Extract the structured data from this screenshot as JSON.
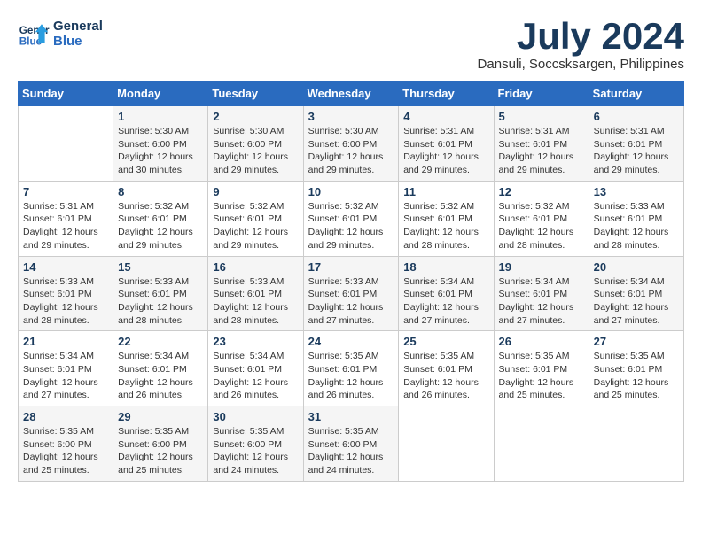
{
  "header": {
    "logo_line1": "General",
    "logo_line2": "Blue",
    "month": "July 2024",
    "location": "Dansuli, Soccsksargen, Philippines"
  },
  "weekdays": [
    "Sunday",
    "Monday",
    "Tuesday",
    "Wednesday",
    "Thursday",
    "Friday",
    "Saturday"
  ],
  "weeks": [
    [
      {
        "day": "",
        "info": ""
      },
      {
        "day": "1",
        "info": "Sunrise: 5:30 AM\nSunset: 6:00 PM\nDaylight: 12 hours\nand 30 minutes."
      },
      {
        "day": "2",
        "info": "Sunrise: 5:30 AM\nSunset: 6:00 PM\nDaylight: 12 hours\nand 29 minutes."
      },
      {
        "day": "3",
        "info": "Sunrise: 5:30 AM\nSunset: 6:00 PM\nDaylight: 12 hours\nand 29 minutes."
      },
      {
        "day": "4",
        "info": "Sunrise: 5:31 AM\nSunset: 6:01 PM\nDaylight: 12 hours\nand 29 minutes."
      },
      {
        "day": "5",
        "info": "Sunrise: 5:31 AM\nSunset: 6:01 PM\nDaylight: 12 hours\nand 29 minutes."
      },
      {
        "day": "6",
        "info": "Sunrise: 5:31 AM\nSunset: 6:01 PM\nDaylight: 12 hours\nand 29 minutes."
      }
    ],
    [
      {
        "day": "7",
        "info": "Sunrise: 5:31 AM\nSunset: 6:01 PM\nDaylight: 12 hours\nand 29 minutes."
      },
      {
        "day": "8",
        "info": "Sunrise: 5:32 AM\nSunset: 6:01 PM\nDaylight: 12 hours\nand 29 minutes."
      },
      {
        "day": "9",
        "info": "Sunrise: 5:32 AM\nSunset: 6:01 PM\nDaylight: 12 hours\nand 29 minutes."
      },
      {
        "day": "10",
        "info": "Sunrise: 5:32 AM\nSunset: 6:01 PM\nDaylight: 12 hours\nand 29 minutes."
      },
      {
        "day": "11",
        "info": "Sunrise: 5:32 AM\nSunset: 6:01 PM\nDaylight: 12 hours\nand 28 minutes."
      },
      {
        "day": "12",
        "info": "Sunrise: 5:32 AM\nSunset: 6:01 PM\nDaylight: 12 hours\nand 28 minutes."
      },
      {
        "day": "13",
        "info": "Sunrise: 5:33 AM\nSunset: 6:01 PM\nDaylight: 12 hours\nand 28 minutes."
      }
    ],
    [
      {
        "day": "14",
        "info": "Sunrise: 5:33 AM\nSunset: 6:01 PM\nDaylight: 12 hours\nand 28 minutes."
      },
      {
        "day": "15",
        "info": "Sunrise: 5:33 AM\nSunset: 6:01 PM\nDaylight: 12 hours\nand 28 minutes."
      },
      {
        "day": "16",
        "info": "Sunrise: 5:33 AM\nSunset: 6:01 PM\nDaylight: 12 hours\nand 28 minutes."
      },
      {
        "day": "17",
        "info": "Sunrise: 5:33 AM\nSunset: 6:01 PM\nDaylight: 12 hours\nand 27 minutes."
      },
      {
        "day": "18",
        "info": "Sunrise: 5:34 AM\nSunset: 6:01 PM\nDaylight: 12 hours\nand 27 minutes."
      },
      {
        "day": "19",
        "info": "Sunrise: 5:34 AM\nSunset: 6:01 PM\nDaylight: 12 hours\nand 27 minutes."
      },
      {
        "day": "20",
        "info": "Sunrise: 5:34 AM\nSunset: 6:01 PM\nDaylight: 12 hours\nand 27 minutes."
      }
    ],
    [
      {
        "day": "21",
        "info": "Sunrise: 5:34 AM\nSunset: 6:01 PM\nDaylight: 12 hours\nand 27 minutes."
      },
      {
        "day": "22",
        "info": "Sunrise: 5:34 AM\nSunset: 6:01 PM\nDaylight: 12 hours\nand 26 minutes."
      },
      {
        "day": "23",
        "info": "Sunrise: 5:34 AM\nSunset: 6:01 PM\nDaylight: 12 hours\nand 26 minutes."
      },
      {
        "day": "24",
        "info": "Sunrise: 5:35 AM\nSunset: 6:01 PM\nDaylight: 12 hours\nand 26 minutes."
      },
      {
        "day": "25",
        "info": "Sunrise: 5:35 AM\nSunset: 6:01 PM\nDaylight: 12 hours\nand 26 minutes."
      },
      {
        "day": "26",
        "info": "Sunrise: 5:35 AM\nSunset: 6:01 PM\nDaylight: 12 hours\nand 25 minutes."
      },
      {
        "day": "27",
        "info": "Sunrise: 5:35 AM\nSunset: 6:01 PM\nDaylight: 12 hours\nand 25 minutes."
      }
    ],
    [
      {
        "day": "28",
        "info": "Sunrise: 5:35 AM\nSunset: 6:00 PM\nDaylight: 12 hours\nand 25 minutes."
      },
      {
        "day": "29",
        "info": "Sunrise: 5:35 AM\nSunset: 6:00 PM\nDaylight: 12 hours\nand 25 minutes."
      },
      {
        "day": "30",
        "info": "Sunrise: 5:35 AM\nSunset: 6:00 PM\nDaylight: 12 hours\nand 24 minutes."
      },
      {
        "day": "31",
        "info": "Sunrise: 5:35 AM\nSunset: 6:00 PM\nDaylight: 12 hours\nand 24 minutes."
      },
      {
        "day": "",
        "info": ""
      },
      {
        "day": "",
        "info": ""
      },
      {
        "day": "",
        "info": ""
      }
    ]
  ]
}
